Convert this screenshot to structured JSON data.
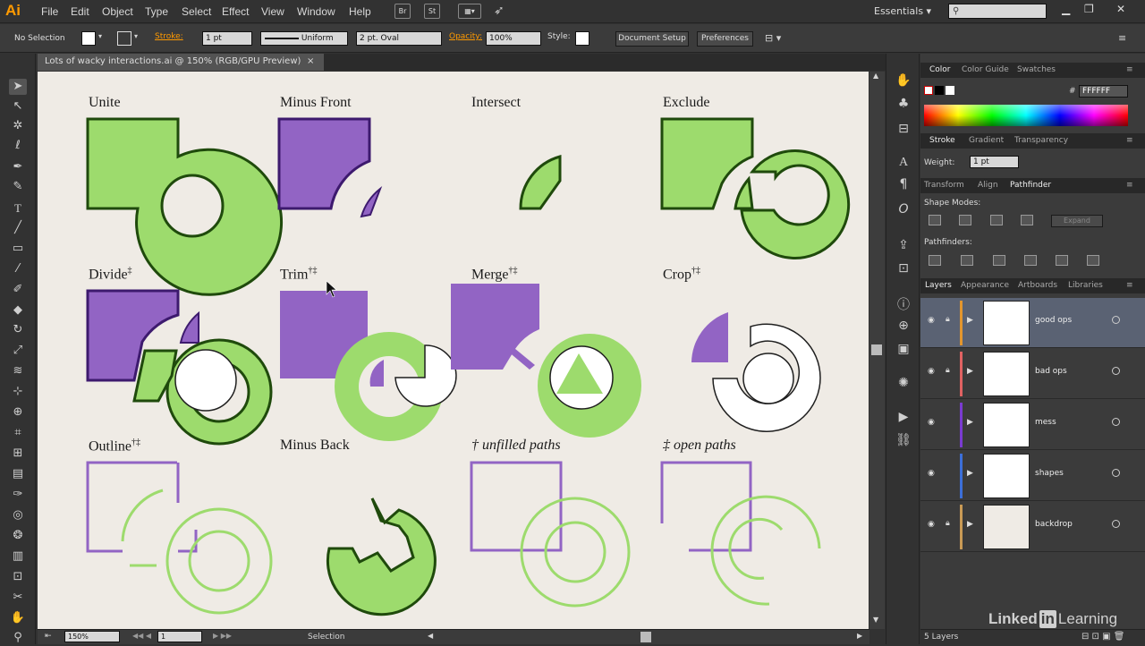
{
  "app": {
    "logo": "Ai",
    "menus": [
      "File",
      "Edit",
      "Object",
      "Type",
      "Select",
      "Effect",
      "View",
      "Window",
      "Help"
    ],
    "bridge_btn": "Br",
    "stock_btn": "St",
    "workspace": "Essentials",
    "accent": "#ff9a00"
  },
  "control": {
    "selection": "No Selection",
    "stroke_label": "Stroke:",
    "stroke_value": "1 pt",
    "profile": "Uniform",
    "brush": "2 pt. Oval",
    "opacity_label": "Opacity:",
    "opacity_value": "100%",
    "style_label": "Style:",
    "doc_setup": "Document Setup",
    "preferences": "Preferences"
  },
  "document": {
    "tab_title": "Lots of wacky interactions.ai @ 150% (RGB/GPU Preview)",
    "close": "×"
  },
  "artboard": {
    "labels": {
      "unite": "Unite",
      "minus_front": "Minus Front",
      "intersect": "Intersect",
      "exclude": "Exclude",
      "divide": "Divide",
      "trim": "Trim",
      "merge": "Merge",
      "crop": "Crop",
      "outline": "Outline",
      "minus_back": "Minus Back",
      "unfilled": "unfilled paths",
      "open": "open paths"
    },
    "marks": {
      "dagger": "†",
      "double_dagger": "‡",
      "both": "†‡"
    },
    "colors": {
      "green": "#9ddb6d",
      "green_stroke": "#1f4a0c",
      "purple": "#9264c4",
      "purple_stroke": "#3d1a6e",
      "bg": "#efebe5"
    }
  },
  "status": {
    "zoom": "150%",
    "artboard_num": "1",
    "mode": "Selection"
  },
  "panels": {
    "color_tabs": [
      "Color",
      "Color Guide",
      "Swatches"
    ],
    "hex_symbol": "#",
    "hex": "FFFFFF",
    "stroke_tabs": [
      "Stroke",
      "Gradient",
      "Transparency"
    ],
    "weight_label": "Weight:",
    "weight_value": "1 pt",
    "pf_tabs": [
      "Transform",
      "Align",
      "Pathfinder"
    ],
    "shape_modes": "Shape Modes:",
    "expand": "Expand",
    "pathfinders": "Pathfinders:",
    "layer_tabs": [
      "Layers",
      "Appearance",
      "Artboards",
      "Libraries"
    ],
    "layers": [
      {
        "name": "good ops",
        "color": "#e3962e"
      },
      {
        "name": "bad ops",
        "color": "#e06262"
      },
      {
        "name": "mess",
        "color": "#7a3bd1"
      },
      {
        "name": "shapes",
        "color": "#3c6fd9"
      },
      {
        "name": "backdrop",
        "color": "#c99a55"
      }
    ],
    "layer_count": "5 Layers"
  },
  "watermark": {
    "brand": "Linked",
    "in": "in",
    "suffix": "Learning"
  }
}
